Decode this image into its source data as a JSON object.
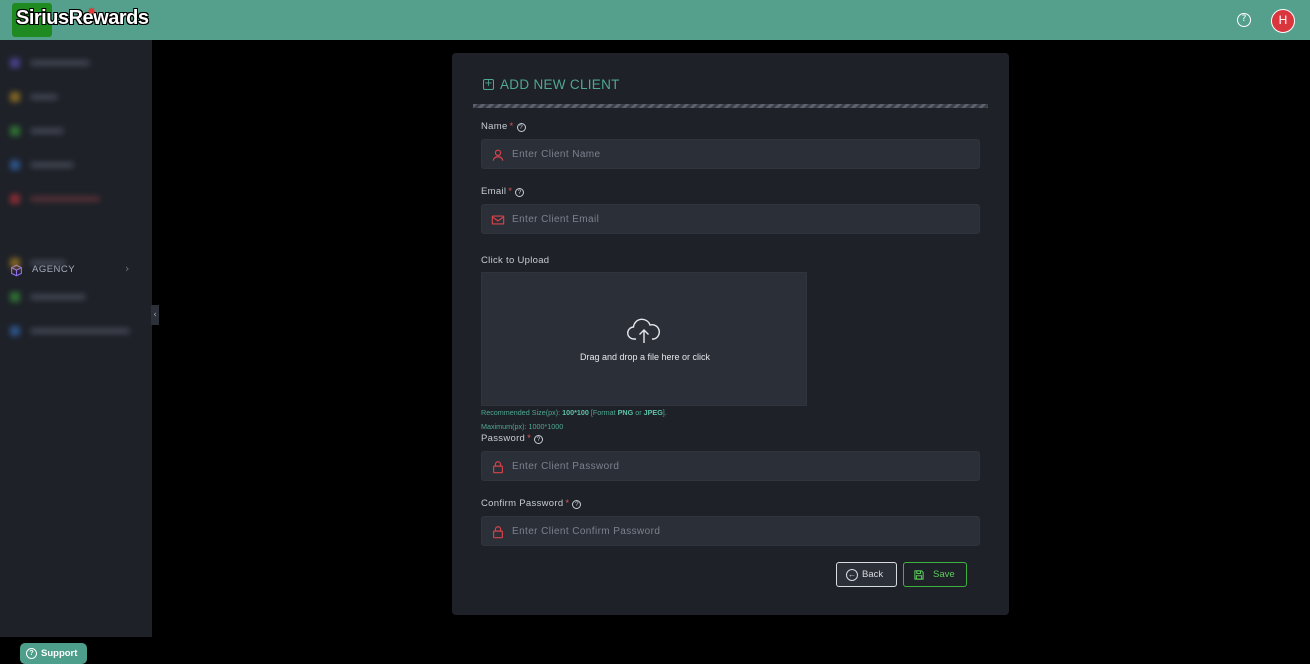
{
  "header": {
    "logo_text": "SiriusRewards",
    "avatar_initial": "H"
  },
  "sidebar": {
    "agency_label": "AGENCY",
    "support_label": "Support"
  },
  "form": {
    "title": "ADD NEW CLIENT",
    "name_label": "Name",
    "name_placeholder": "Enter Client Name",
    "email_label": "Email",
    "email_placeholder": "Enter Client Email",
    "upload_label": "Click to Upload",
    "upload_text": "Drag and drop a file here or click",
    "hint_recommended_prefix": "Recommended Size(px): ",
    "hint_recommended_size": "100*100",
    "hint_format_prefix": " [Format ",
    "hint_png": "PNG",
    "hint_or": " or ",
    "hint_jpeg": "JPEG",
    "hint_format_suffix": "].",
    "hint_maximum": "Maximum(px): 1000*1000",
    "password_label": "Password",
    "password_placeholder": "Enter Client Password",
    "confirm_label": "Confirm Password",
    "confirm_placeholder": "Enter Client Confirm Password",
    "required_mark": "*",
    "back_label": "Back",
    "save_label": "Save"
  },
  "colors": {
    "topbar": "#55a08d",
    "accent": "#4fa891",
    "danger": "#d9434b",
    "save": "#3fb13f"
  }
}
